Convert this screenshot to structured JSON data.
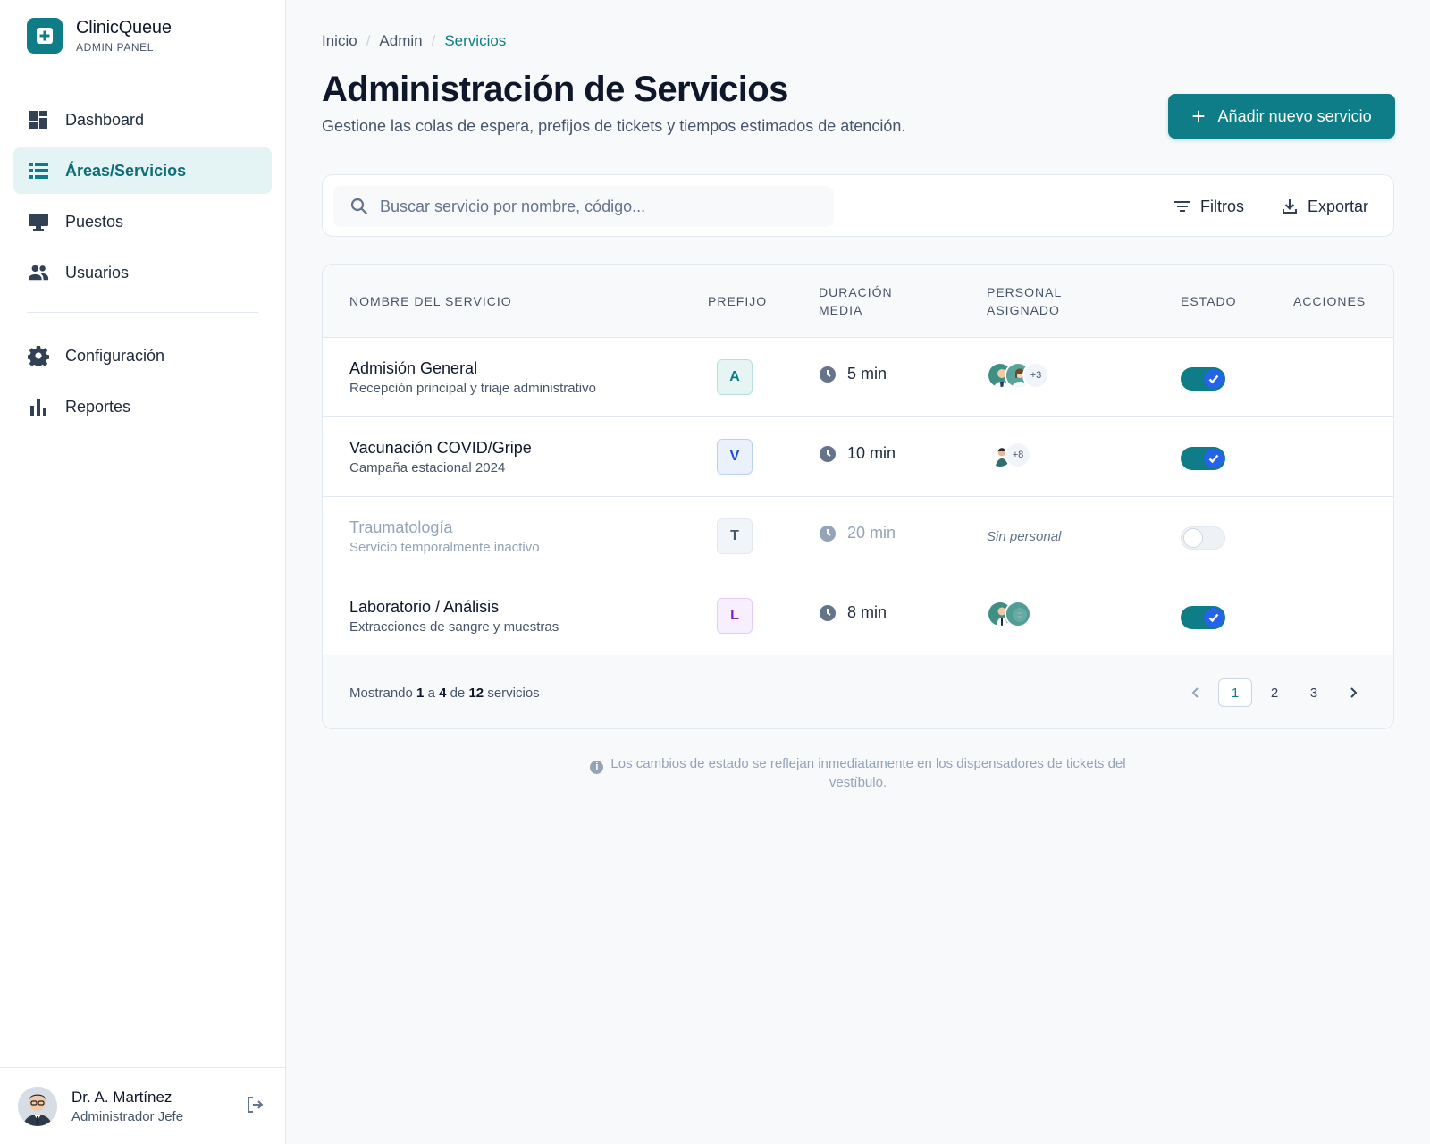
{
  "app": {
    "name": "ClinicQueue",
    "subtitle": "ADMIN PANEL"
  },
  "sidebar": {
    "items": [
      {
        "label": "Dashboard",
        "icon": "dashboard-icon"
      },
      {
        "label": "Áreas/Servicios",
        "icon": "list-icon",
        "active": true
      },
      {
        "label": "Puestos",
        "icon": "monitor-icon"
      },
      {
        "label": "Usuarios",
        "icon": "users-icon"
      },
      {
        "label": "Configuración",
        "icon": "gear-icon"
      },
      {
        "label": "Reportes",
        "icon": "bar-chart-icon"
      }
    ]
  },
  "user": {
    "name": "Dr. A. Martínez",
    "role": "Administrador Jefe"
  },
  "breadcrumb": {
    "home": "Inicio",
    "admin": "Admin",
    "current": "Servicios"
  },
  "header": {
    "title": "Administración de Servicios",
    "subtitle": "Gestione las colas de espera, prefijos de tickets y tiempos estimados de atención.",
    "add_button": "Añadir nuevo servicio"
  },
  "toolbar": {
    "search_placeholder": "Buscar servicio por nombre, código...",
    "filters_label": "Filtros",
    "export_label": "Exportar"
  },
  "table": {
    "columns": {
      "name": "NOMBRE DEL SERVICIO",
      "prefix": "PREFIJO",
      "duration_1": "DURACIÓN",
      "duration_2": "MEDIA",
      "staff_1": "PERSONAL",
      "staff_2": "ASIGNADO",
      "status": "ESTADO",
      "actions": "ACCIONES"
    },
    "rows": [
      {
        "name": "Admisión General",
        "description": "Recepción principal y triaje administrativo",
        "prefix": "A",
        "prefix_color": "#0e7d87",
        "duration": "5 min",
        "staff_more": "+3",
        "active": true
      },
      {
        "name": "Vacunación COVID/Gripe",
        "description": "Campaña estacional 2024",
        "prefix": "V",
        "prefix_color": "#1d4ed8",
        "duration": "10 min",
        "staff_more": "+8",
        "active": true
      },
      {
        "name": "Traumatología",
        "description": "Servicio temporalmente inactivo",
        "prefix": "T",
        "prefix_color": "#475569",
        "duration": "20 min",
        "staff_text": "Sin personal",
        "active": false
      },
      {
        "name": "Laboratorio / Análisis",
        "description": "Extracciones de sangre y muestras",
        "prefix": "L",
        "prefix_color": "#7e22ce",
        "duration": "8 min",
        "active": true
      }
    ]
  },
  "footer": {
    "showing_prefix": "Mostrando",
    "from": "1",
    "a": "a",
    "to": "4",
    "de": "de",
    "total": "12",
    "suffix": "servicios",
    "pages": [
      "1",
      "2",
      "3"
    ]
  },
  "note": "Los cambios de estado se reflejan inmediatamente en los dispensadores de tickets del vestíbulo.",
  "colors": {
    "accent": "#0e7d87",
    "toggle_check": "#2563eb"
  }
}
